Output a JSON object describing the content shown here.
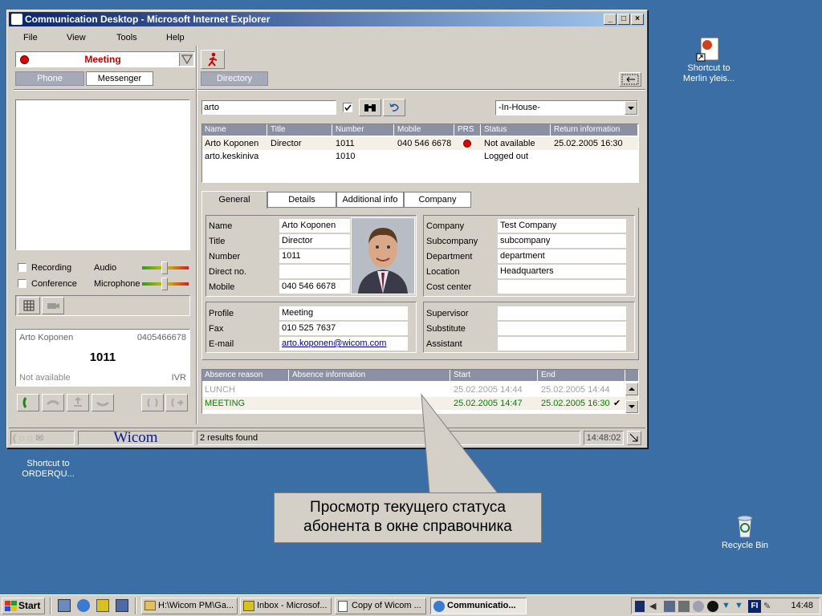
{
  "window": {
    "title": "Communication Desktop - Microsoft Internet Explorer",
    "controls": [
      "_",
      "□",
      "×"
    ]
  },
  "menu": [
    "File",
    "View",
    "Tools",
    "Help"
  ],
  "left": {
    "profile": "Meeting",
    "tabs": [
      "Phone",
      "Messenger"
    ],
    "checkboxes": [
      "Recording",
      "Conference"
    ],
    "volume_labels": [
      "Audio",
      "Microphone"
    ],
    "call": {
      "name": "Arto Koponen",
      "phone": "0405466678",
      "number": "1011",
      "status": "Not available",
      "ivr": "IVR"
    }
  },
  "directory": {
    "tab": "Directory",
    "search_value": "arto",
    "location": "-In-House-",
    "columns": [
      "Name",
      "Title",
      "Number",
      "Mobile",
      "PRS",
      "Status",
      "Return information"
    ],
    "rows": [
      {
        "name": "Arto Koponen",
        "title": "Director",
        "number": "1011",
        "mobile": "040 546 6678",
        "status": "Not available",
        "return": "25.02.2005 16:30"
      },
      {
        "name": "arto.keskiniva",
        "title": "",
        "number": "1010",
        "mobile": "",
        "status": "Logged out",
        "return": ""
      }
    ],
    "detail_tabs": [
      "General",
      "Details",
      "Additional info",
      "Company"
    ],
    "general": {
      "labels": [
        "Name",
        "Title",
        "Number",
        "Direct no.",
        "Mobile"
      ],
      "values": [
        "Arto Koponen",
        "Director",
        "1011",
        "",
        "040 546 6678"
      ]
    },
    "company": {
      "labels": [
        "Company",
        "Subcompany",
        "Department",
        "Location",
        "Cost center"
      ],
      "values": [
        "Test Company",
        "subcompany",
        "department",
        "Headquarters",
        ""
      ]
    },
    "profile": {
      "labels": [
        "Profile",
        "Fax",
        "E-mail"
      ],
      "values": [
        "Meeting",
        "010 525 7637",
        "arto.koponen@wicom.com"
      ]
    },
    "supervisor": {
      "labels": [
        "Supervisor",
        "Substitute",
        "Assistant"
      ],
      "values": [
        "",
        "",
        ""
      ]
    },
    "absence_columns": [
      "Absence reason",
      "Absence information",
      "Start",
      "End"
    ],
    "absence_rows": [
      {
        "reason": "LUNCH",
        "start": "25.02.2005 14:44",
        "end": "25.02.2005 14:44"
      },
      {
        "reason": "MEETING",
        "start": "25.02.2005 14:47",
        "end": "25.02.2005 16:30"
      }
    ]
  },
  "status_bar": {
    "brand": "Wicom",
    "message": "2 results found",
    "time": "14:48:02"
  },
  "desktop_icons": [
    {
      "label": "Shortcut to Merlin yleis..."
    },
    {
      "label": "Shortcut to ORDERQU..."
    },
    {
      "label": "Recycle Bin"
    }
  ],
  "callout": {
    "line1": "Просмотр текущего статуса",
    "line2": "абонента в окне справочника"
  },
  "taskbar": {
    "start": "Start",
    "tasks": [
      "H:\\Wicom PM\\Ga...",
      "Inbox - Microsof...",
      "Copy of Wicom ...",
      "Communicatio..."
    ],
    "lang": "FI",
    "clock": "14:48"
  },
  "colors": {
    "desktop": "#3a6ea5",
    "title_start": "#0a246a",
    "header_grey": "#8c90a4",
    "status_red": "#e00000",
    "absence_green": "#008000"
  }
}
